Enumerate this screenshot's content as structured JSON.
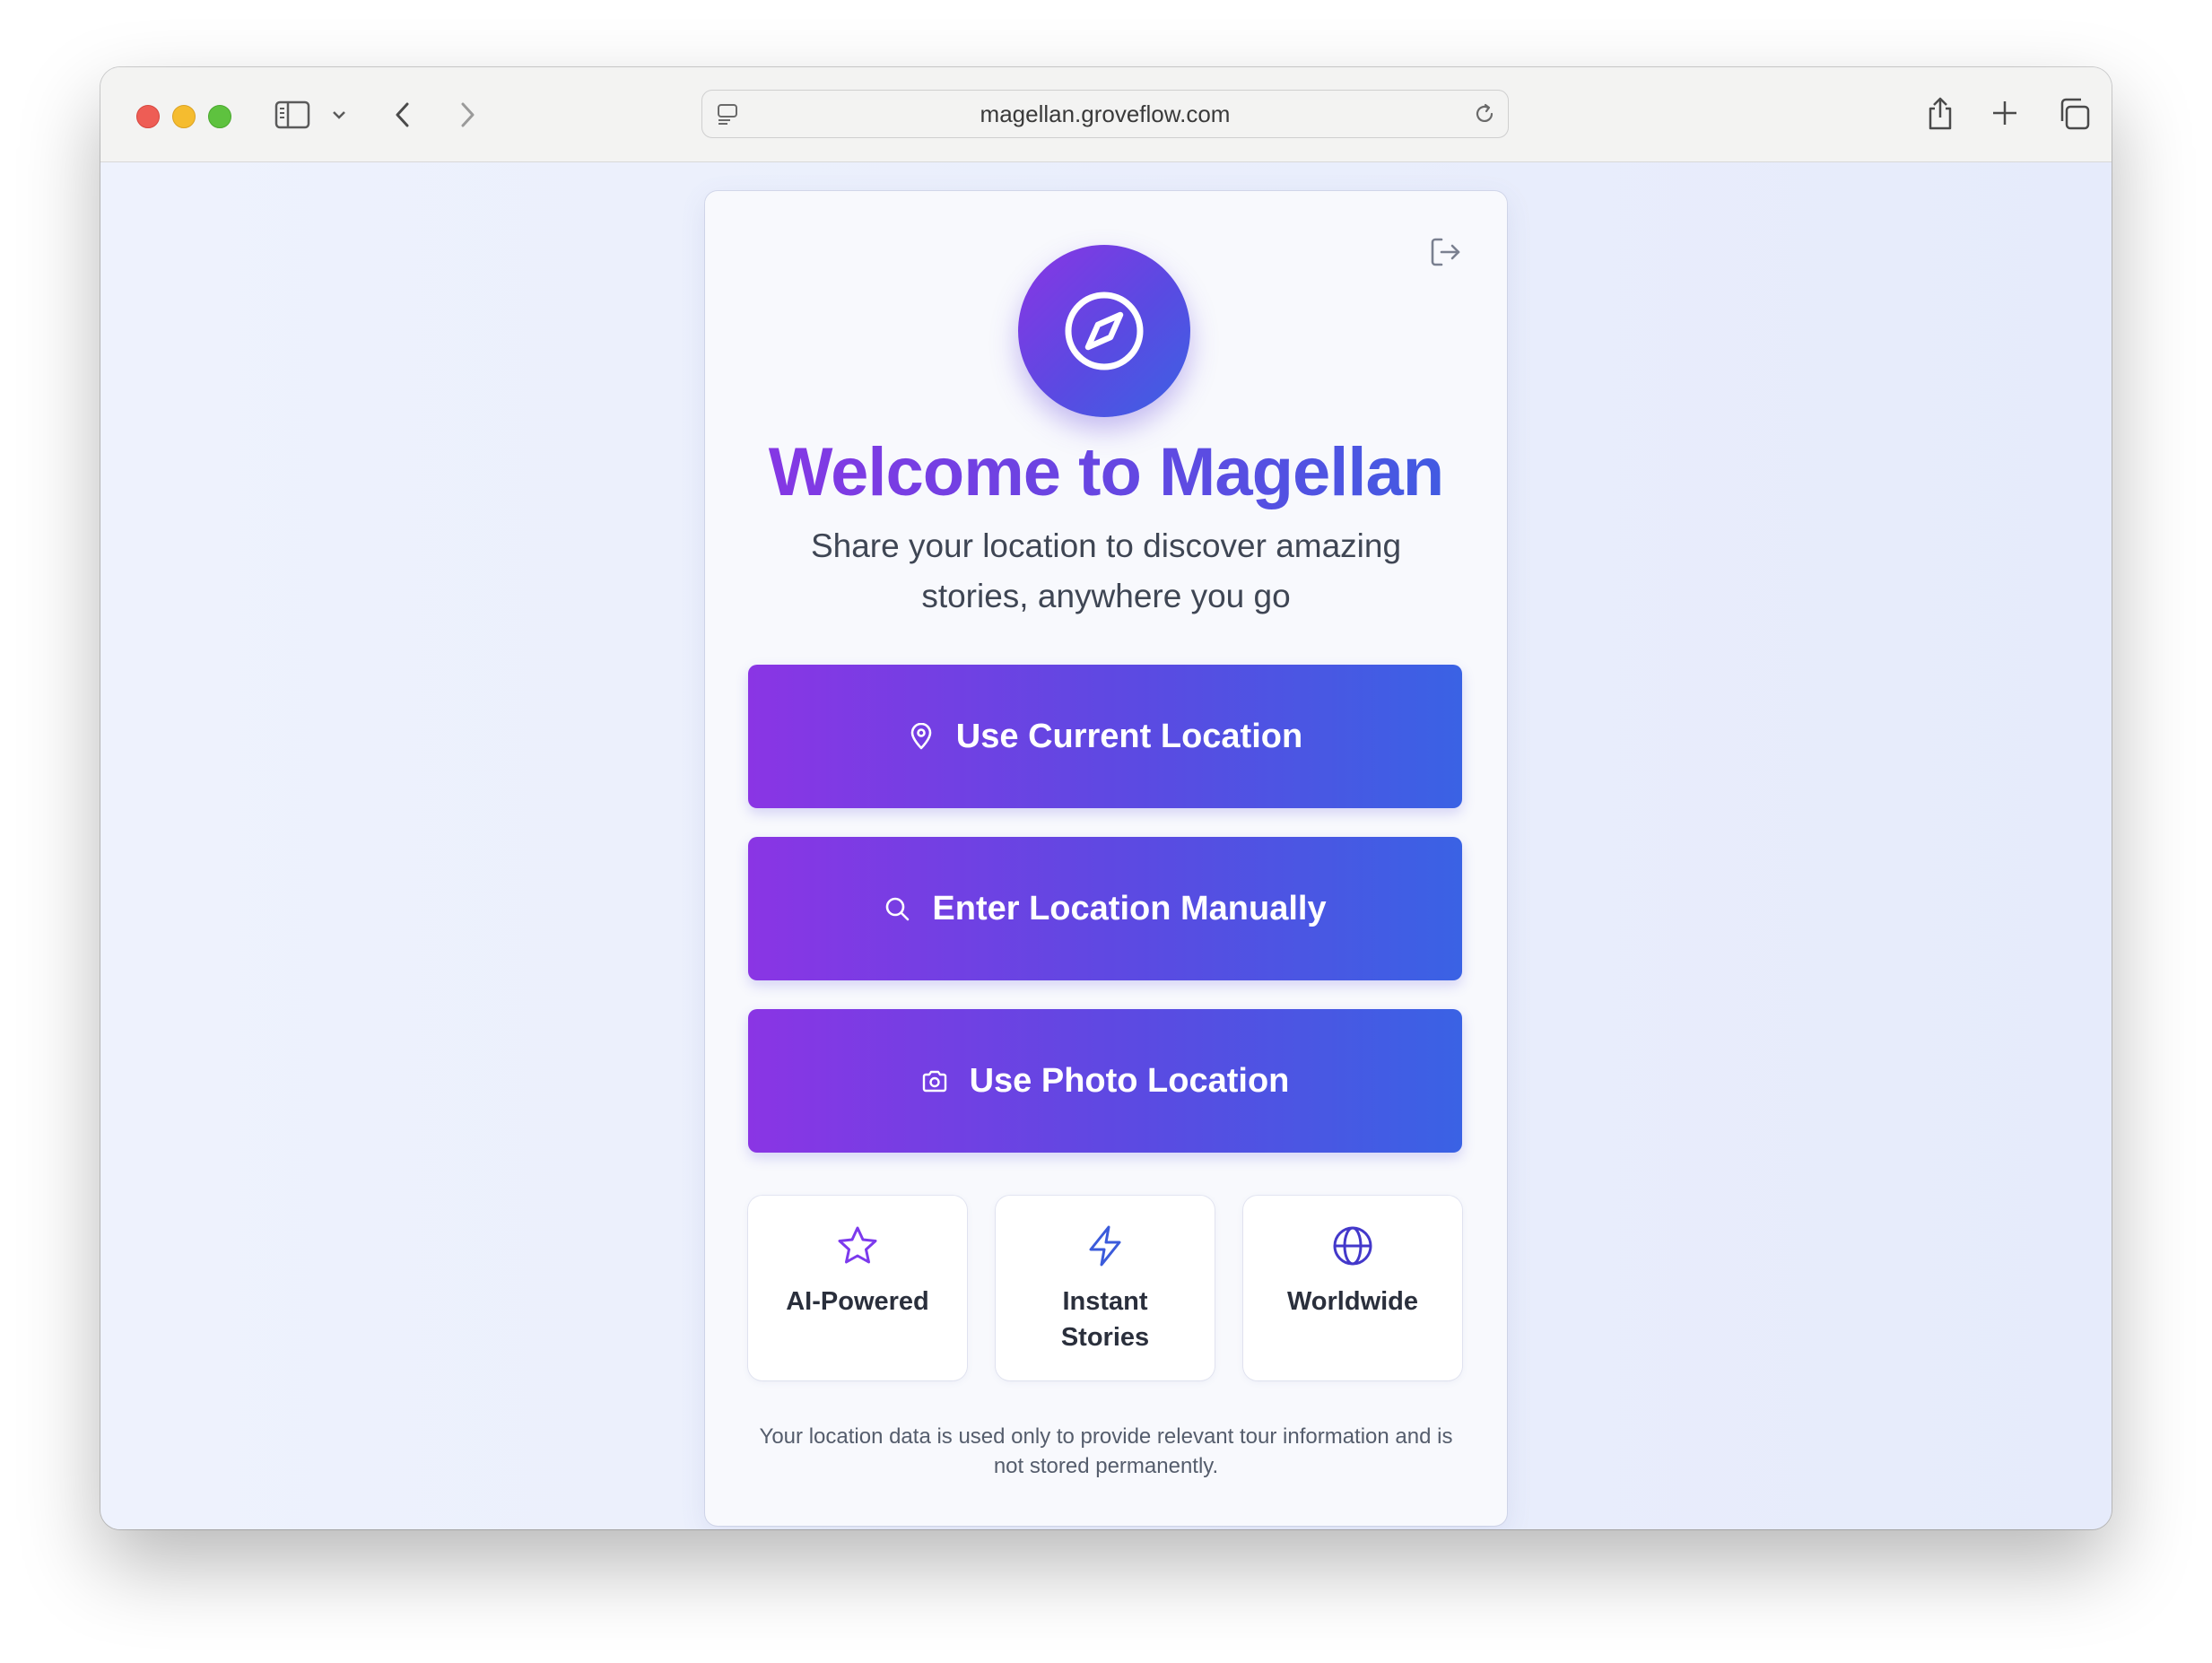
{
  "browser": {
    "url": "magellan.groveflow.com"
  },
  "card": {
    "title": "Welcome to Magellan",
    "subtitle": "Share your location to discover amazing stories, anywhere you go",
    "buttons": [
      {
        "label": "Use Current Location",
        "icon": "map-pin-icon"
      },
      {
        "label": "Enter Location Manually",
        "icon": "search-icon"
      },
      {
        "label": "Use Photo Location",
        "icon": "camera-icon"
      }
    ],
    "features": [
      {
        "label": "AI-Powered",
        "icon": "star-icon",
        "color": "#7c3aed"
      },
      {
        "label": "Instant Stories",
        "icon": "lightning-icon",
        "color": "#3b5bdb"
      },
      {
        "label": "Worldwide",
        "icon": "globe-icon",
        "color": "#4338ca"
      }
    ],
    "privacy": "Your location data is used only to provide relevant tour information and is not stored permanently."
  },
  "colors": {
    "gradient_start": "#8a35e4",
    "gradient_end": "#3b62e4"
  }
}
